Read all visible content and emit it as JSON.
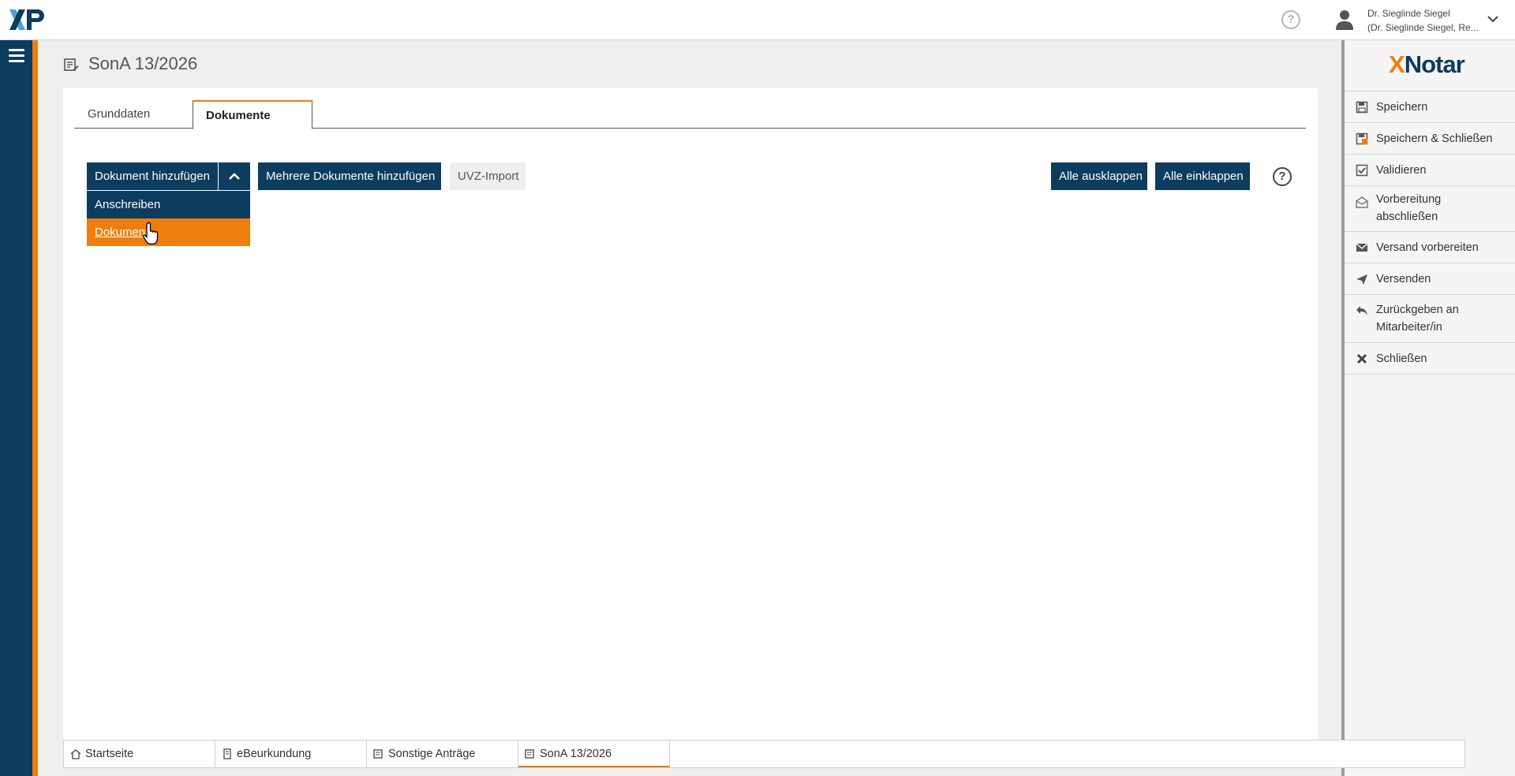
{
  "topbar": {
    "logo_text": "XP",
    "help_icon": "?",
    "user_name": "Dr. Sieglinde Siegel",
    "user_sub": "(Dr. Sieglinde Siegel, Re..."
  },
  "page": {
    "title": "SonA 13/2026"
  },
  "tabs": [
    {
      "label": "Grunddaten",
      "active": false
    },
    {
      "label": "Dokumente",
      "active": true
    }
  ],
  "toolbar": {
    "add_document": "Dokument hinzufügen",
    "add_multiple": "Mehrere Dokumente hinzufügen",
    "uvz_import": "UVZ-Import",
    "expand_all": "Alle ausklappen",
    "collapse_all": "Alle einklappen",
    "help": "?"
  },
  "dropdown": {
    "items": [
      {
        "label": "Anschreiben"
      },
      {
        "label": "Dokument",
        "hovered": true
      }
    ]
  },
  "sidebar": {
    "logo_x": "X",
    "logo_rest": "Notar",
    "items": [
      {
        "label": "Speichern",
        "icon": "floppy-icon"
      },
      {
        "label": "Speichern & Schließen",
        "icon": "floppy-close-icon"
      },
      {
        "label": "Validieren",
        "icon": "check-square-icon"
      },
      {
        "label": "Vorbereitung",
        "label2": "abschließen",
        "icon": "envelope-open-icon"
      },
      {
        "label": "Versand vorbereiten",
        "icon": "envelope-icon"
      },
      {
        "label": "Versenden",
        "icon": "paper-plane-icon"
      },
      {
        "label": "Zurückgeben an",
        "label2": "Mitarbeiter/in",
        "icon": "reply-icon"
      },
      {
        "label": "Schließen",
        "icon": "x-icon"
      }
    ]
  },
  "bottom_tabs": [
    {
      "label": "Startseite",
      "icon": "home-icon",
      "active": false
    },
    {
      "label": "eBeurkundung",
      "icon": "scroll-icon",
      "active": false
    },
    {
      "label": "Sonstige Anträge",
      "icon": "document-edit-icon",
      "active": false
    },
    {
      "label": "SonA 13/2026",
      "icon": "document-edit-icon",
      "active": true
    }
  ],
  "colors": {
    "primary": "#0c3c5e",
    "accent": "#ef7d0f",
    "background": "#efefef"
  }
}
